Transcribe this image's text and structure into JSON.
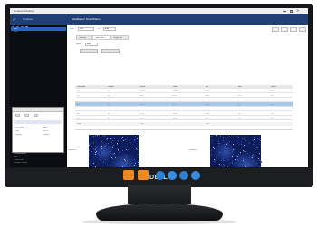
{
  "window": {
    "title": "Nucleus Desktop",
    "tab": "Nucleus",
    "heading": "ModMaster SmartPanel"
  },
  "menu": {
    "label": "Runs",
    "items": [
      "Start",
      "Stop",
      "Scan",
      "Export"
    ]
  },
  "sidebar": {
    "items": [
      {
        "label": "Run 1"
      },
      {
        "label": "Run 2"
      }
    ],
    "panel": {
      "tabs": [
        "Status",
        "Settings"
      ],
      "rows": [
        {
          "label": "Run Mode",
          "value": "Auto"
        },
        {
          "label": "Time",
          "value": "00:00"
        },
        {
          "label": "Sample",
          "value": "Ready"
        }
      ]
    },
    "footer": {
      "title": "Current Status",
      "lines": [
        "Idle",
        "Connected",
        "Sample: Ready"
      ]
    }
  },
  "toolbar": {
    "field1_label": "Scan",
    "field1_value": "Rate",
    "field2_label": "Int",
    "field2_value": "Auto",
    "tabs": [
      "Overview",
      "Table View",
      "Image View"
    ],
    "sub_label": "Mode",
    "sub_value": "Auto"
  },
  "table": {
    "columns": [
      "Parameter",
      "Sample",
      "Value",
      "Units",
      "Min",
      "Max",
      "Status"
    ],
    "rows": [
      [
        "R1",
        "S1",
        "0.18",
        "0.18",
        "0.61",
        "1.0",
        "1.0"
      ],
      [
        "R2",
        "S1",
        "0.20",
        "0.21",
        "0.62",
        "1.0",
        "1.0"
      ],
      [
        "R3",
        "S1",
        "0.25",
        "0.25",
        "0.63",
        "1.0",
        "1.0"
      ],
      [
        "R4",
        "S1",
        "0.22",
        "0.22",
        "0.64",
        "1.0",
        "1.0"
      ],
      [
        "R5",
        "S1",
        "0.21",
        "0.22",
        "0.65",
        "1.0",
        "1.0"
      ],
      [
        "R6",
        "S1",
        "0.19",
        "0.20",
        "0.66",
        "1.0",
        "1.0"
      ],
      [
        "R7",
        "S1",
        "0.24",
        "0.24",
        "0.67",
        "1.0",
        "1.0"
      ]
    ],
    "footer": [
      "Total",
      "",
      "1.49",
      "",
      "4.48",
      "",
      ""
    ]
  },
  "images": {
    "left_label": "Sample A",
    "right_label": "Sample B"
  },
  "monitor": {
    "brand": "DELL"
  },
  "colors": {
    "menubar": "#1f3f75",
    "sidebar": "#0b0d12",
    "selection": "#2a63b8",
    "highlight_row": "#a9c7ea",
    "heatmap": "#0e1c5a"
  },
  "dock_icons": [
    "folder-icon",
    "orange-app-icon",
    "blue-app-icon",
    "browser-icon",
    "settings-icon",
    "app-icon"
  ]
}
